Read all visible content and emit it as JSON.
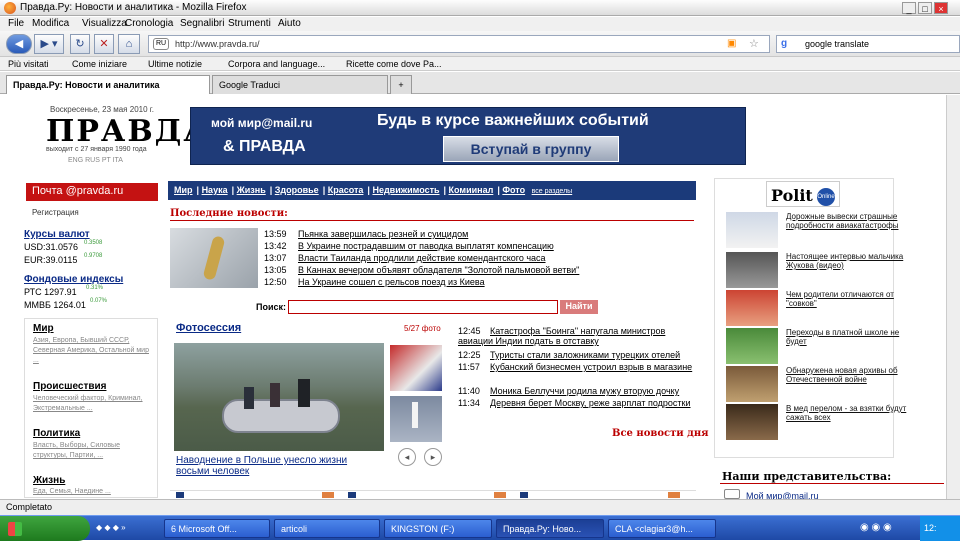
{
  "window": {
    "title": "Правда.Ру: Новости и аналитика - Mozilla Firefox"
  },
  "menu": [
    "File",
    "Modifica",
    "Visualizza",
    "Cronologia",
    "Segnalibri",
    "Strumenti",
    "Aiuto"
  ],
  "nav": {
    "url": "http://www.pravda.ru/",
    "search_value": "google translate"
  },
  "bookmarks": [
    "Più visitati",
    "Come iniziare",
    "Ultime notizie",
    "Corpora and language...",
    "Ricette come dove Pa..."
  ],
  "tabs": [
    {
      "label": "Правда.Ру: Новости и аналитика"
    },
    {
      "label": "Google Traduci"
    },
    {
      "label": "+"
    }
  ],
  "header": {
    "date": "Воскресенье, 23 мая 2010 г.",
    "logo": "ПРАВДА",
    "since": "выходит с 27 января 1990 года",
    "langs": "ENG  RUS  PT  ITA"
  },
  "banner": {
    "brand": "мой мир@mail.ru",
    "partner": "& ПРАВДА",
    "headline": "Будь в курсе важнейших событий",
    "button": "Вступай в группу"
  },
  "left": {
    "mail": "Почта @pravda.ru",
    "register": "Регистрация",
    "currency_title": "Курсы валют",
    "usd": "USD:31.0576",
    "usd_change": "0.3508",
    "eur": "EUR:39.0115",
    "eur_change": "0.9708",
    "index_title": "Фондовые индексы",
    "rts": "РТС 1297.91",
    "rts_change": "0.31%",
    "micex": "ММВБ 1264.01",
    "micex_change": "0.07%",
    "sections": [
      {
        "title": "Мир",
        "sub": "Азия, Европа, Бывший СССР, Северная Америка, Остальной мир ..."
      },
      {
        "title": "Происшествия",
        "sub": "Человеческий фактор, Криминал, Экстремальные ..."
      },
      {
        "title": "Политика",
        "sub": "Власть, Выборы, Силовые структуры, Партии, ..."
      },
      {
        "title": "Жизнь",
        "sub": "Еда, Семья, Наедине ..."
      }
    ]
  },
  "topnav": {
    "items": [
      "Мир",
      "Наука",
      "Жизнь",
      "Здоровье",
      "Красота",
      "Недвижимость",
      "Комиинал",
      "Фото",
      "все разделы"
    ]
  },
  "latest": {
    "title": "Последние новости:",
    "items": [
      {
        "time": "13:59",
        "text": "Пьянка завершилась резней и суицидом"
      },
      {
        "time": "13:42",
        "text": "В Украине пострадавшим от паводка выплатят компенсацию"
      },
      {
        "time": "13:07",
        "text": "Власти Таиланда продлили действие комендантского часа"
      },
      {
        "time": "13:05",
        "text": "В Каннах вечером объявят обладателя \"Золотой пальмовой ветви\""
      },
      {
        "time": "12:50",
        "text": "На Украине сошел с рельсов поезд из Киева"
      }
    ]
  },
  "search": {
    "label": "Поиск:",
    "button": "Найти"
  },
  "photo": {
    "title": "Фотосессия",
    "count": "5/27 фото",
    "caption": "Наводнение в Польше унесло жизни восьми человек"
  },
  "news2": [
    {
      "time": "12:45",
      "text": "Катастрофа \"Боинга\" напугала министров авиации Индии подать в отставку"
    },
    {
      "time": "12:25",
      "text": "Туристы стали заложниками турецких отелей"
    },
    {
      "time": "11:57",
      "text": "Кубанский бизнесмен устроил взрыв в магазине"
    },
    {
      "time": "11:40",
      "text": "Моника Беллуччи родила мужу вторую дочку"
    },
    {
      "time": "11:34",
      "text": "Деревня берет Москву, реже зарплат подростки"
    }
  ],
  "all_news": "Все новости дня",
  "right": {
    "polit": "Polit",
    "online": "Online",
    "items": [
      {
        "text": "Дорожные вывески страшные подробности авиакатастрофы"
      },
      {
        "text": "Настоящее интервью мальчика Жукова (видео)"
      },
      {
        "text": "Чем родители отличаются от \"совков\""
      },
      {
        "text": "Переходы в платной школе не будет"
      },
      {
        "text": "Обнаружена новая архивы об Отечественной войне"
      },
      {
        "text": "В мед перелом - за взятки будут сажать всех"
      }
    ],
    "repr": "Наши представительства:",
    "mymir": "Мой мир@mail.ru"
  },
  "status": "Completato",
  "taskbar": {
    "tasks": [
      "6 Microsoft Off...",
      "articoli",
      "KINGSTON (F:)",
      "Правда.Ру: Ново...",
      "CLA <clagiar3@h..."
    ],
    "clock": "12:"
  }
}
